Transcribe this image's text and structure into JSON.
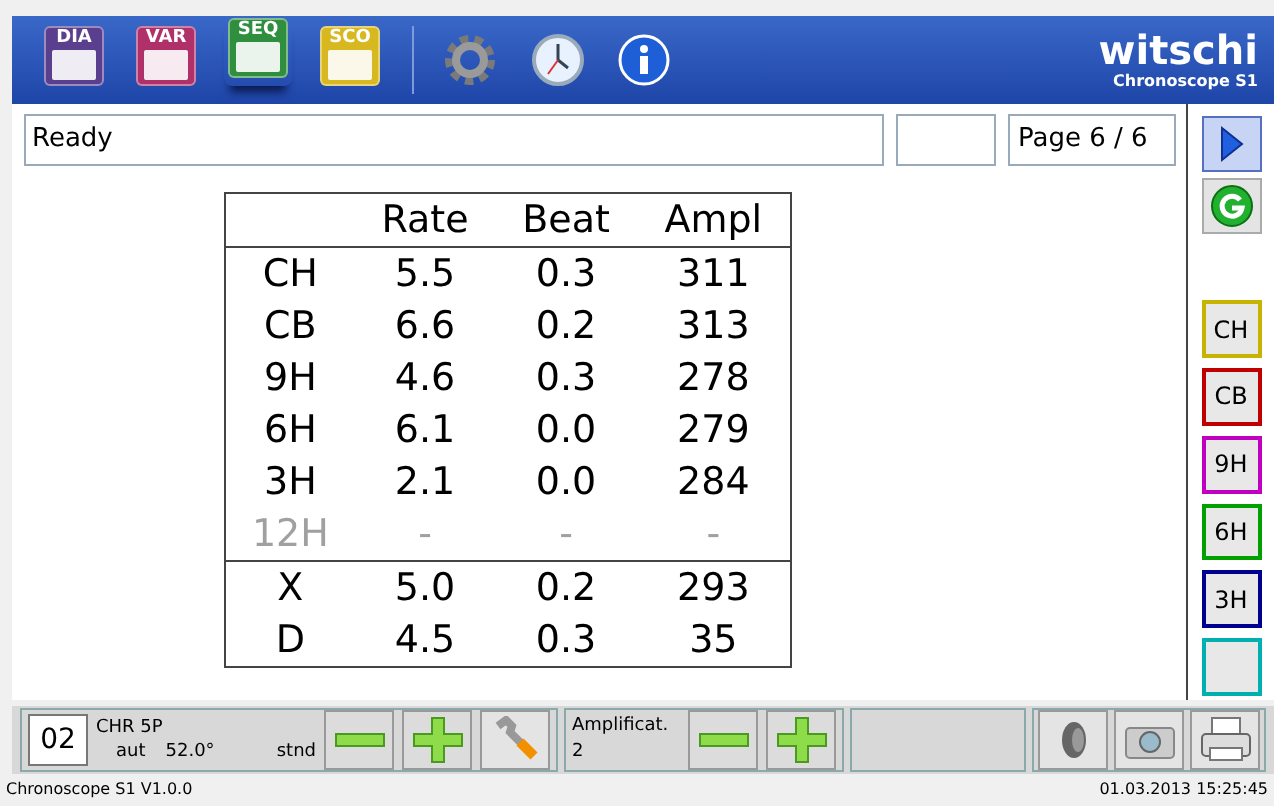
{
  "toolbar": {
    "items": [
      {
        "label": "DIA",
        "kind": "dia",
        "selected": false
      },
      {
        "label": "VAR",
        "kind": "var",
        "selected": false
      },
      {
        "label": "SEQ",
        "kind": "seq",
        "selected": true
      },
      {
        "label": "SCO",
        "kind": "sco",
        "selected": false
      }
    ],
    "tools": [
      {
        "kind": "settings"
      },
      {
        "kind": "clock"
      },
      {
        "kind": "info"
      }
    ]
  },
  "logo": {
    "brand": "witschi",
    "product": "Chronoscope S1"
  },
  "status_field": "Ready",
  "page_field": "Page 6 / 6",
  "table": {
    "columns": [
      "Rate",
      "Beat",
      "Ampl"
    ],
    "rows": [
      {
        "label": "CH",
        "values": [
          "5.5",
          "0.3",
          "311"
        ],
        "disabled": false
      },
      {
        "label": "CB",
        "values": [
          "6.6",
          "0.2",
          "313"
        ],
        "disabled": false
      },
      {
        "label": "9H",
        "values": [
          "4.6",
          "0.3",
          "278"
        ],
        "disabled": false
      },
      {
        "label": "6H",
        "values": [
          "6.1",
          "0.0",
          "279"
        ],
        "disabled": false
      },
      {
        "label": "3H",
        "values": [
          "2.1",
          "0.0",
          "284"
        ],
        "disabled": false
      },
      {
        "label": "12H",
        "values": [
          "-",
          "-",
          "-"
        ],
        "disabled": true
      }
    ],
    "summary_rows": [
      {
        "label": "X",
        "values": [
          "5.0",
          "0.2",
          "293"
        ]
      },
      {
        "label": "D",
        "values": [
          "4.5",
          "0.3",
          "35"
        ]
      }
    ]
  },
  "side_buttons": [
    {
      "label": "CH",
      "color": "#c8b400"
    },
    {
      "label": "CB",
      "color": "#c00000"
    },
    {
      "label": "9H",
      "color": "#c000c0"
    },
    {
      "label": "6H",
      "color": "#00a000"
    },
    {
      "label": "3H",
      "color": "#000090"
    },
    {
      "color": "#00b0b0"
    }
  ],
  "bottom": {
    "number": "02",
    "model": "CHR 5P",
    "mode": "aut",
    "angle": "52.0°",
    "standard": "stnd",
    "amplification_label": "Amplificat.",
    "amplification_value": "2"
  },
  "footer": {
    "version": "Chronoscope S1 V1.0.0",
    "datetime": "01.03.2013 15:25:45"
  }
}
